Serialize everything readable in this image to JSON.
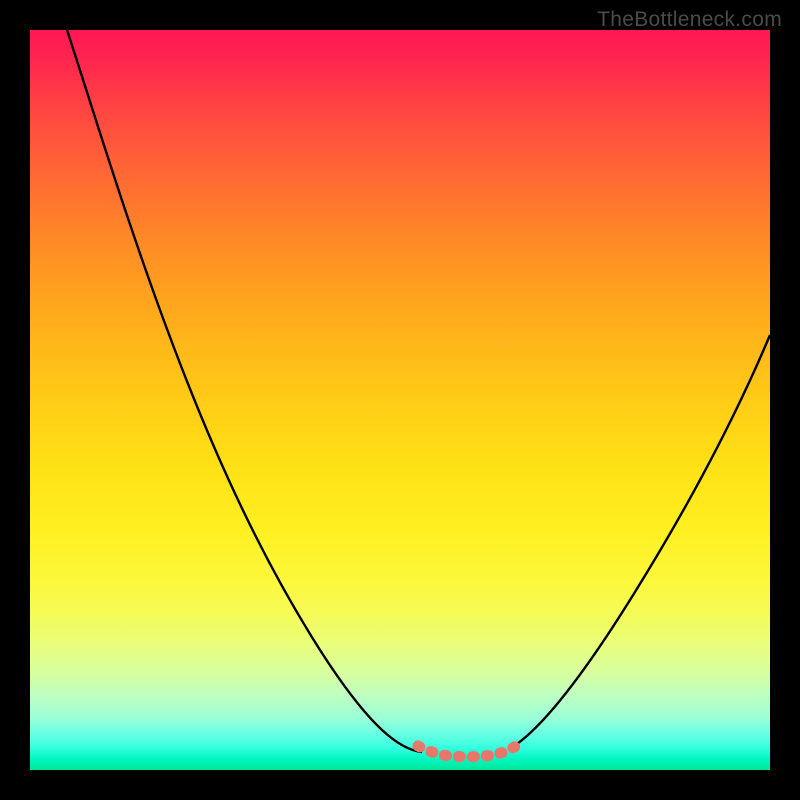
{
  "watermark": "TheBottleneck.com",
  "chart_data": {
    "type": "line",
    "title": "",
    "xlabel": "",
    "ylabel": "",
    "xlim": [
      0,
      100
    ],
    "ylim": [
      0,
      100
    ],
    "grid": false,
    "legend": false,
    "background": "rainbow-gradient-vertical",
    "series": [
      {
        "name": "left-descending-curve",
        "color": "#000000",
        "x": [
          5,
          10,
          15,
          20,
          25,
          30,
          35,
          40,
          45,
          49,
          51,
          53
        ],
        "y": [
          100,
          92,
          83,
          73,
          63,
          52,
          41,
          30,
          19,
          10,
          6,
          3.5
        ]
      },
      {
        "name": "valley-floor-marker",
        "color": "#e8766b",
        "style": "thick-dotted",
        "x": [
          53,
          55,
          57,
          59,
          61,
          63,
          65
        ],
        "y": [
          3.2,
          3.0,
          2.9,
          2.9,
          3.0,
          3.2,
          3.6
        ]
      },
      {
        "name": "right-ascending-curve",
        "color": "#000000",
        "x": [
          65,
          70,
          75,
          80,
          85,
          90,
          95,
          100
        ],
        "y": [
          4,
          9,
          16,
          24,
          33,
          43,
          53,
          62
        ]
      }
    ],
    "annotations": []
  }
}
